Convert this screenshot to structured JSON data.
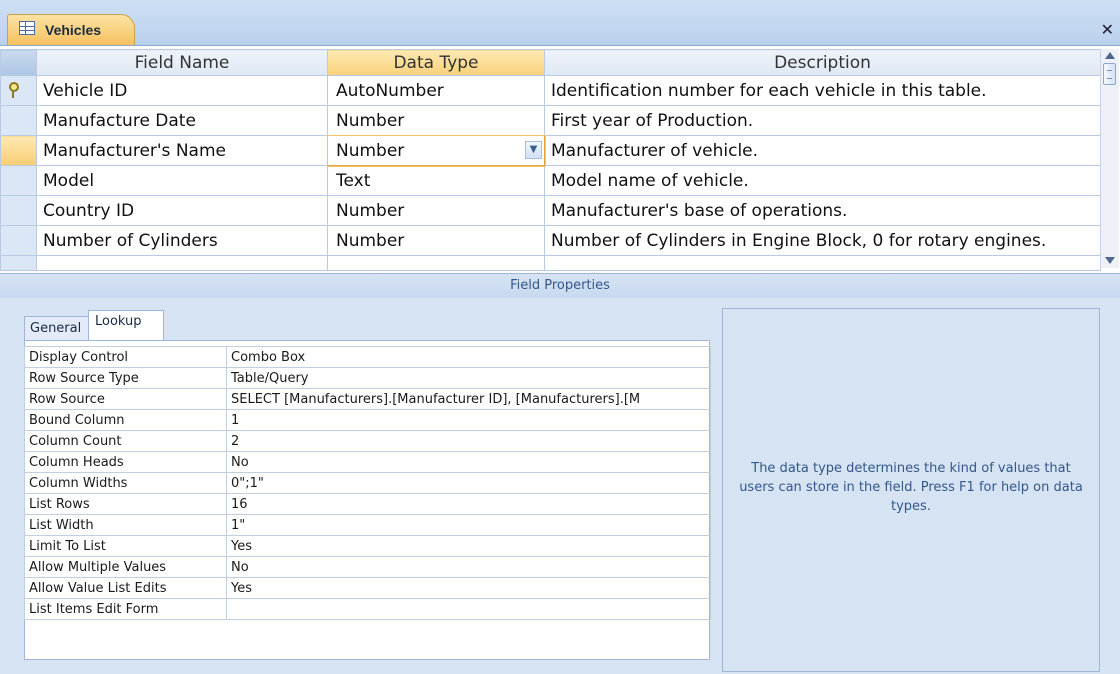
{
  "tab_title": "Vehicles",
  "columns": {
    "field_name": "Field Name",
    "data_type": "Data Type",
    "description": "Description"
  },
  "rows": [
    {
      "field_name": "Vehicle ID",
      "data_type": "AutoNumber",
      "description": "Identification number for each vehicle in this table."
    },
    {
      "field_name": "Manufacture Date",
      "data_type": "Number",
      "description": "First year of Production."
    },
    {
      "field_name": "Manufacturer's Name",
      "data_type": "Number",
      "description": "Manufacturer of vehicle."
    },
    {
      "field_name": "Model",
      "data_type": "Text",
      "description": "Model name of vehicle."
    },
    {
      "field_name": "Country ID",
      "data_type": "Number",
      "description": "Manufacturer's base of operations."
    },
    {
      "field_name": "Number of Cylinders",
      "data_type": "Number",
      "description": "Number of Cylinders in Engine Block, 0 for rotary engines."
    }
  ],
  "field_properties_header": "Field Properties",
  "property_tabs": {
    "general": "General",
    "lookup": "Lookup"
  },
  "lookup_properties": [
    {
      "label": "Display Control",
      "value": "Combo Box"
    },
    {
      "label": "Row Source Type",
      "value": "Table/Query"
    },
    {
      "label": "Row Source",
      "value": "SELECT [Manufacturers].[Manufacturer ID], [Manufacturers].[M"
    },
    {
      "label": "Bound Column",
      "value": "1"
    },
    {
      "label": "Column Count",
      "value": "2"
    },
    {
      "label": "Column Heads",
      "value": "No"
    },
    {
      "label": "Column Widths",
      "value": "0\";1\""
    },
    {
      "label": "List Rows",
      "value": "16"
    },
    {
      "label": "List Width",
      "value": "1\""
    },
    {
      "label": "Limit To List",
      "value": "Yes"
    },
    {
      "label": "Allow Multiple Values",
      "value": "No"
    },
    {
      "label": "Allow Value List Edits",
      "value": "Yes"
    },
    {
      "label": "List Items Edit Form",
      "value": ""
    }
  ],
  "help_text": "The data type determines the kind of values that users can store in the field.  Press F1 for help on data types.",
  "icons": {
    "tab_icon": "table-icon",
    "close": "close-icon",
    "primary_key": "primary-key-icon",
    "dropdown": "chevron-down-icon"
  },
  "colors": {
    "selected_header": "#f9d17a",
    "panel_background": "#d6e3f3",
    "help_text": "#34578a"
  }
}
